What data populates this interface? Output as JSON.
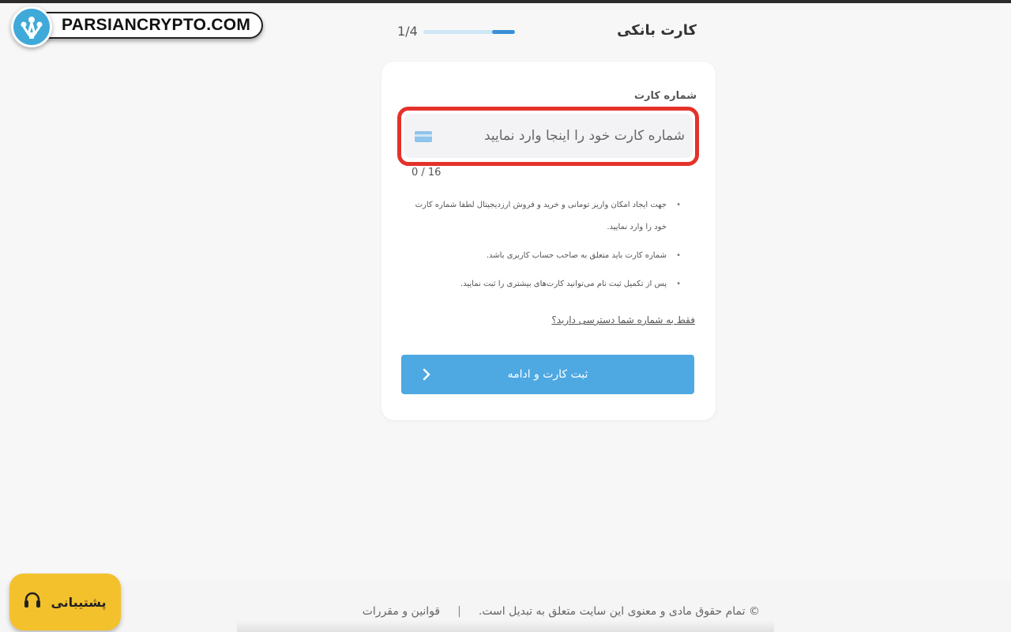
{
  "watermark": {
    "text": "PARSIANCRYPTO.COM"
  },
  "header": {
    "title": "کارت بانکی",
    "step": "1/4",
    "progress": 0.25
  },
  "form": {
    "label": "شماره کارت",
    "input_value": "",
    "placeholder": "شماره کارت خود را اینجا وارد نمایید",
    "counter": "0 / 16",
    "notes": [
      "جهت ایجاد امکان واریز تومانی و خرید و فروش ارزدیجیتال لطفا شماره کارت خود را وارد نمایید.",
      "شماره کارت باید متعلق به صاحب حساب کاربری باشد.",
      "پس از تکمیل ثبت نام می‌توانید کارت‌های بیشتری را ثبت نمایید."
    ],
    "phone_link": "فقط به شماره شما دسترسی دارید؟",
    "submit_label": "ثبت کارت و ادامه"
  },
  "footer": {
    "copyright": "© تمام حقوق مادی و معنوی این سایت متعلق به تبدیل است.",
    "separator": "|",
    "rules_link": "قوانین و مقررات"
  },
  "support": {
    "label": "پشتیبانی"
  },
  "colors": {
    "accent": "#4ea8e2",
    "highlight": "#e4322b",
    "support": "#f3c12c"
  }
}
